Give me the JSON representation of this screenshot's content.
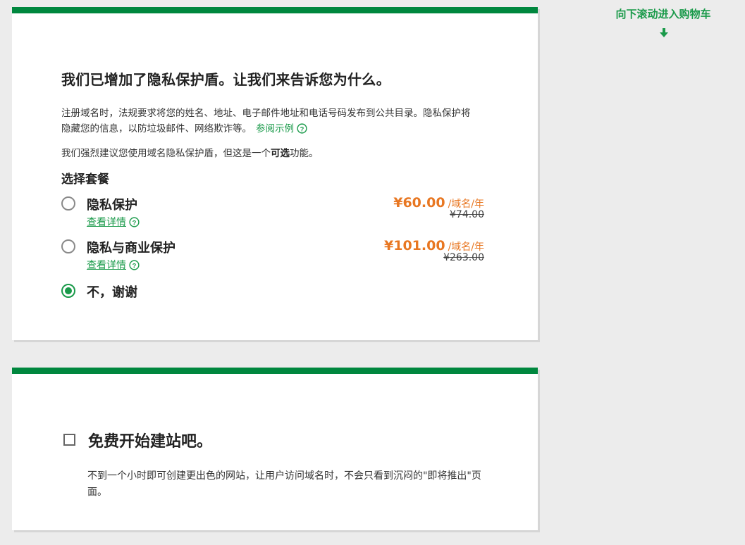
{
  "scroll_hint": {
    "label": "向下滚动进入购物车"
  },
  "privacy": {
    "title": "我们已增加了隐私保护盾。让我们来告诉您为什么。",
    "desc_text": "注册域名时，法规要求将您的姓名、地址、电子邮件地址和电话号码发布到公共目录。隐私保护将隐藏您的信息，以防垃圾邮件、网络欺诈等。",
    "example_link": "参阅示例",
    "recommend_before": "我们强烈建议您使用域名隐私保护盾，但这是一个",
    "recommend_bold": "可选",
    "recommend_after": "功能。",
    "choose_label": "选择套餐",
    "options": [
      {
        "label": "隐私保护",
        "details": "查看详情",
        "price": "¥60.00",
        "unit": "/域名/年",
        "original": "¥74.00",
        "selected": false
      },
      {
        "label": "隐私与商业保护",
        "details": "查看详情",
        "price": "¥101.00",
        "unit": "/域名/年",
        "original": "¥263.00",
        "selected": false
      },
      {
        "label": "不，谢谢",
        "selected": true
      }
    ]
  },
  "website": {
    "title": "免费开始建站吧。",
    "desc": "不到一个小时即可创建更出色的网站，让用户访问域名时，不会只看到沉闷的\"即将推出\"页面。",
    "checked": false
  },
  "colors": {
    "accent_green": "#00873e",
    "link_green": "#1a9a4a",
    "price_orange": "#e87722"
  }
}
